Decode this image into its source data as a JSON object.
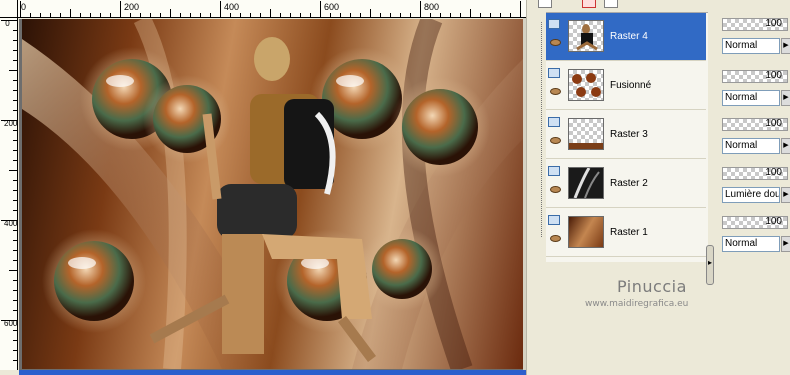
{
  "rulers": {
    "top_labels": [
      "0",
      "200",
      "400",
      "600",
      "800"
    ],
    "left_labels": [
      "0",
      "200",
      "400",
      "600"
    ]
  },
  "canvas": {
    "artwork_description_icon": "collage-image"
  },
  "layers": [
    {
      "name": "Raster 4",
      "selected": true,
      "thumb": "figure"
    },
    {
      "name": "Fusionné",
      "selected": false,
      "thumb": "spheres"
    },
    {
      "name": "Raster 3",
      "selected": false,
      "thumb": "checker-strip"
    },
    {
      "name": "Raster 2",
      "selected": false,
      "thumb": "black-curves"
    },
    {
      "name": "Raster 1",
      "selected": false,
      "thumb": "brown"
    }
  ],
  "properties": [
    {
      "opacity": "100",
      "blend": "Normal"
    },
    {
      "opacity": "100",
      "blend": "Normal"
    },
    {
      "opacity": "100",
      "blend": "Normal"
    },
    {
      "opacity": "100",
      "blend": "Lumière douce"
    },
    {
      "opacity": "100",
      "blend": "Normal"
    }
  ],
  "watermark": {
    "name": "Pinuccia",
    "url": "www.maidiregrafica.eu"
  },
  "colors": {
    "selection": "#316ac5",
    "panel_bg": "#ece9d8"
  }
}
